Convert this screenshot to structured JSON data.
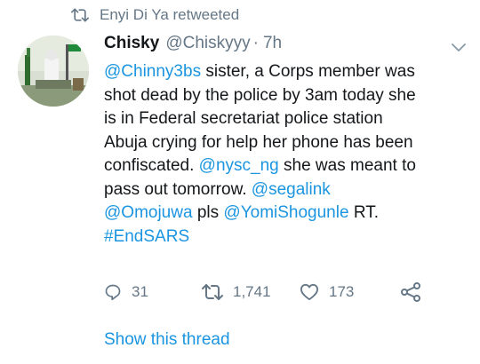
{
  "retweet_banner": {
    "icon": "retweet-icon",
    "text": "Enyi Di Ya retweeted"
  },
  "tweet": {
    "author_name": "Chisky",
    "handle": "@Chiskyyy",
    "separator": "·",
    "time": "7h",
    "text_lines": [
      [
        {
          "t": "@Chinny3bs",
          "link": true
        },
        {
          "t": " sister, a Corps member was",
          "link": false
        }
      ],
      [
        {
          "t": "shot dead by the police by 3am today she",
          "link": false
        }
      ],
      [
        {
          "t": "is in Federal secretariat police station",
          "link": false
        }
      ],
      [
        {
          "t": "Abuja crying for help  her phone has been",
          "link": false
        }
      ],
      [
        {
          "t": "confiscated. ",
          "link": false
        },
        {
          "t": "@nysc_ng",
          "link": true
        },
        {
          "t": " she was meant to",
          "link": false
        }
      ],
      [
        {
          "t": "pass out tomorrow. ",
          "link": false
        },
        {
          "t": "@segalink",
          "link": true
        }
      ],
      [
        {
          "t": "@Omojuwa",
          "link": true
        },
        {
          "t": " pls ",
          "link": false
        },
        {
          "t": "@YomiShogunle",
          "link": true
        },
        {
          "t": " RT.",
          "link": false
        }
      ],
      [
        {
          "t": "#EndSARS",
          "link": true
        }
      ]
    ],
    "actions": {
      "reply_count": "31",
      "retweet_count": "1,741",
      "like_count": "173"
    },
    "show_thread": "Show this thread"
  },
  "colors": {
    "link": "#1b95e0",
    "muted": "#657786",
    "text": "#14171a"
  }
}
